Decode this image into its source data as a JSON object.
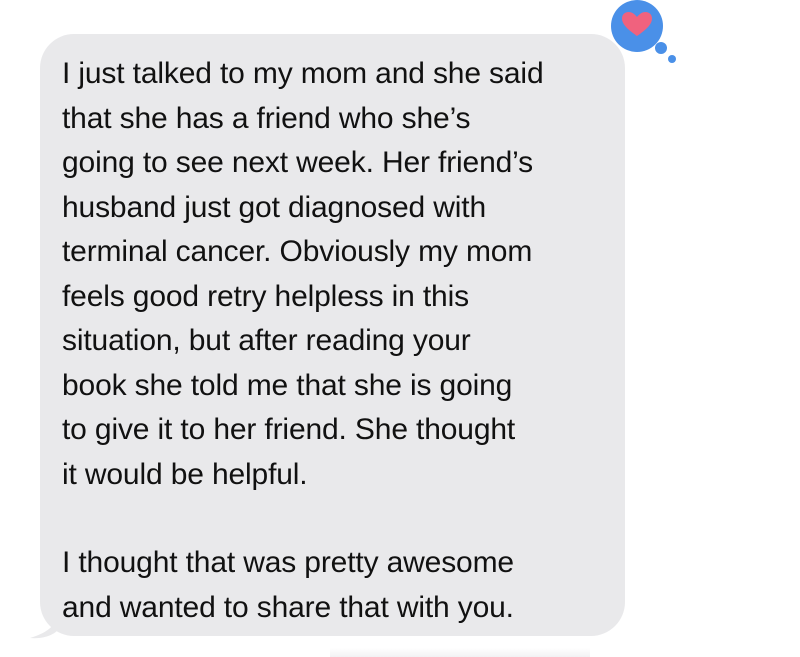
{
  "message": {
    "paragraphs": [
      "I just talked to my mom and she said\nthat she has a friend who she’s\ngoing to see next week. Her friend’s\nhusband just got diagnosed with\nterminal cancer. Obviously my mom\nfeels good retry helpless in this\nsituation, but after reading your\nbook she told me that she is going\nto give it to her friend. She thought\nit would be helpful.",
      "I thought that was pretty awesome\nand wanted to share that with you."
    ],
    "bubble_color": "#e9e9eb",
    "text_color": "#111111"
  },
  "reaction": {
    "icon": "heart-icon",
    "bubble_color": "#4a90e8",
    "heart_color": "#f0627e"
  }
}
